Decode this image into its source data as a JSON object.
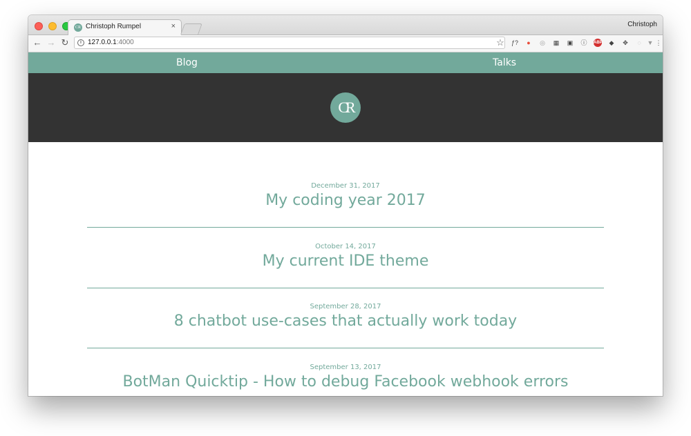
{
  "browser": {
    "tab_title": "Christoph Rumpel",
    "tab_close": "×",
    "tab_favicon": "CR",
    "profile_name": "Christoph",
    "url_host": "127.0.0.1",
    "url_port": ":4000",
    "nav": {
      "back": "←",
      "forward": "→",
      "reload": "↻"
    },
    "star": "☆",
    "extensions": [
      "ƒ?",
      "●",
      "◎",
      "▦",
      "▣",
      "ⓘ",
      "ABP",
      "◆",
      "✥",
      "◌",
      "▼",
      "⋮"
    ]
  },
  "site": {
    "nav": {
      "blog": "Blog",
      "talks": "Talks"
    },
    "logo": "CR",
    "colors": {
      "accent": "#72a99b",
      "hero": "#333333"
    }
  },
  "posts": [
    {
      "date": "December 31, 2017",
      "title": "My coding year 2017"
    },
    {
      "date": "October 14, 2017",
      "title": "My current IDE theme"
    },
    {
      "date": "September 28, 2017",
      "title": "8 chatbot use-cases that actually work today"
    },
    {
      "date": "September 13, 2017",
      "title": "BotMan Quicktip - How to debug Facebook webhook errors"
    }
  ]
}
